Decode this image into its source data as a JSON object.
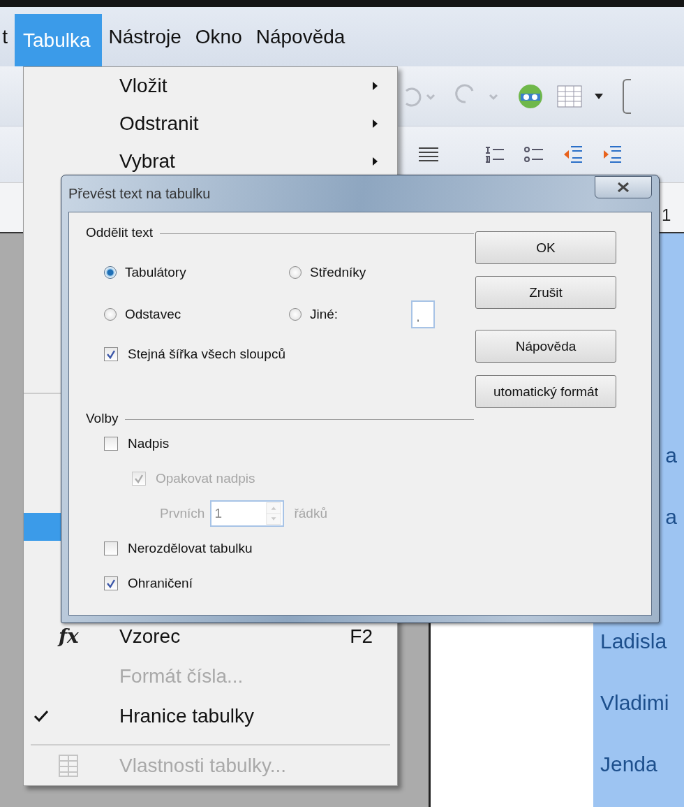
{
  "menubar": [
    {
      "label": "t",
      "selected": false
    },
    {
      "label": "Tabulka",
      "selected": true
    },
    {
      "label": "Nástroje",
      "selected": false
    },
    {
      "label": "Okno",
      "selected": false
    },
    {
      "label": "Nápověda",
      "selected": false
    }
  ],
  "ruler": {
    "mark": "1"
  },
  "menu": {
    "top_items": [
      {
        "label": "Vložit",
        "submenu": true
      },
      {
        "label": "Odstranit",
        "submenu": true
      },
      {
        "label": "Vybrat",
        "submenu": true
      }
    ],
    "bottom_items": [
      {
        "kind": "formula",
        "label": "Vzorec",
        "icon_text": "fx",
        "shortcut": "F2",
        "disabled": false,
        "checked": false
      },
      {
        "kind": "plain",
        "label": "Formát čísla...",
        "disabled": true,
        "checked": false
      },
      {
        "kind": "plain",
        "label": "Hranice tabulky",
        "disabled": false,
        "checked": true
      },
      {
        "kind": "table",
        "label": "Vlastnosti tabulky...",
        "disabled": true,
        "checked": false
      }
    ]
  },
  "dialog": {
    "title": "Převést text na tabulku",
    "separate": {
      "legend": "Oddělit text",
      "options": [
        {
          "label": "Tabulátory",
          "selected": true
        },
        {
          "label": "Středníky",
          "selected": false
        },
        {
          "label": "Odstavec",
          "selected": false
        },
        {
          "label": "Jiné:",
          "selected": false
        }
      ],
      "other_value": ",",
      "equal_width": {
        "label": "Stejná šířka všech sloupců",
        "checked": true
      }
    },
    "options": {
      "legend": "Volby",
      "items": [
        {
          "kind": "checkbox",
          "label": "Nadpis",
          "checked": false,
          "disabled": false,
          "children": [
            {
              "kind": "checkbox",
              "label": "Opakovat nadpis",
              "checked": true,
              "disabled": true,
              "children": [
                {
                  "kind": "spin",
                  "label": "Prvních",
                  "value": "1",
                  "unit": "řádků",
                  "disabled": true
                }
              ]
            }
          ]
        },
        {
          "kind": "checkbox",
          "label": "Nerozdělovat tabulku",
          "checked": false,
          "disabled": false
        },
        {
          "kind": "checkbox",
          "label": "Ohraničení",
          "checked": true,
          "disabled": false
        }
      ]
    },
    "buttons": [
      "OK",
      "Zrušit",
      "Nápověda",
      "utomatický formát"
    ]
  },
  "document": {
    "cells": [
      {
        "text": "a",
        "kind": "tail"
      },
      {
        "text": "a",
        "kind": "tail"
      },
      {
        "text": "Ladisla",
        "kind": "name"
      },
      {
        "text": "Vladimi",
        "kind": "name"
      },
      {
        "text": "Jenda",
        "kind": "name"
      }
    ]
  }
}
